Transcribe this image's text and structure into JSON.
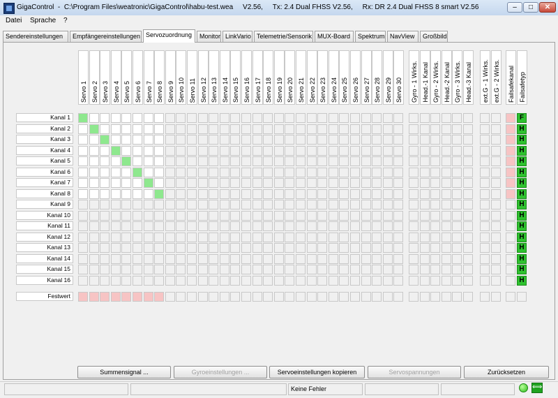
{
  "window": {
    "app_name": "GigaControl",
    "title_path": "C:\\Program Files\\weatronic\\GigaControl\\habu-test.wea",
    "version": "V2.56,",
    "tx": "Tx: 2.4 Dual FHSS V2.56,",
    "rx": "Rx: DR 2.4 Dual FHSS 8 smart V2.56",
    "minimize": "–",
    "maximize": "□",
    "close": "✕"
  },
  "menu": [
    "Datei",
    "Sprache",
    "?"
  ],
  "tabs": [
    "Sendereinstellungen",
    "Empfängereinstellungen",
    "Servozuordnung",
    "Monitor",
    "LinkVario",
    "Telemetrie/Sensorik",
    "MUX-Board",
    "Spektrum",
    "NavView",
    "Großbild"
  ],
  "active_tab": "Servozuordnung",
  "grid": {
    "columns": [
      "Servo 1",
      "Servo 2",
      "Servo 3",
      "Servo 4",
      "Servo 5",
      "Servo 6",
      "Servo 7",
      "Servo 8",
      "Servo 9",
      "Servo 10",
      "Servo 11",
      "Servo 12",
      "Servo 13",
      "Servo 14",
      "Servo 15",
      "Servo 16",
      "Servo 17",
      "Servo 18",
      "Servo 19",
      "Servo 20",
      "Servo 21",
      "Servo 22",
      "Servo 23",
      "Servo 24",
      "Servo 25",
      "Servo 26",
      "Servo 27",
      "Servo 28",
      "Servo 29",
      "Servo 30"
    ],
    "gyro_columns": [
      "Gyro - 1 Wirks.",
      "Head.-1 Kanal",
      "Gyro - 2 Wirks.",
      "Head.-2 Kanal",
      "Gyro - 3 Wirks.",
      "Head.-3 Kanal"
    ],
    "ext_columns": [
      "ext.G - 1 Wirks.",
      "ext.G - 2 Wirks."
    ],
    "failsafe_columns": [
      "Failsafekanal",
      "Failsafetyp"
    ],
    "rows": [
      "Kanal 1",
      "Kanal 2",
      "Kanal 3",
      "Kanal 4",
      "Kanal 5",
      "Kanal 6",
      "Kanal 7",
      "Kanal 8",
      "Kanal 9",
      "Kanal 10",
      "Kanal 11",
      "Kanal 12",
      "Kanal 13",
      "Kanal 14",
      "Kanal 15",
      "Kanal 16"
    ],
    "assignments": [
      [
        0,
        0
      ],
      [
        1,
        1
      ],
      [
        2,
        2
      ],
      [
        3,
        3
      ],
      [
        4,
        4
      ],
      [
        5,
        5
      ],
      [
        6,
        6
      ],
      [
        7,
        7
      ]
    ],
    "failsafe_channel_rows": 8,
    "failsafe_types": [
      "F",
      "H",
      "H",
      "H",
      "H",
      "H",
      "H",
      "H",
      "H",
      "H",
      "H",
      "H",
      "H",
      "H",
      "H",
      "H"
    ],
    "festwert_label": "Festwert",
    "festwert_active_columns": 8
  },
  "buttons": [
    {
      "label": "Summensignal ...",
      "enabled": true
    },
    {
      "label": "Gyroeinstellungen ...",
      "enabled": false
    },
    {
      "label": "Servoeinstellungen kopieren",
      "enabled": true
    },
    {
      "label": "Servospannungen",
      "enabled": false
    },
    {
      "label": "Zurücksetzen",
      "enabled": true
    }
  ],
  "status": {
    "message": "Keine Fehler",
    "led_color": "#2ebc1a",
    "arrows_icon": "⟺"
  }
}
